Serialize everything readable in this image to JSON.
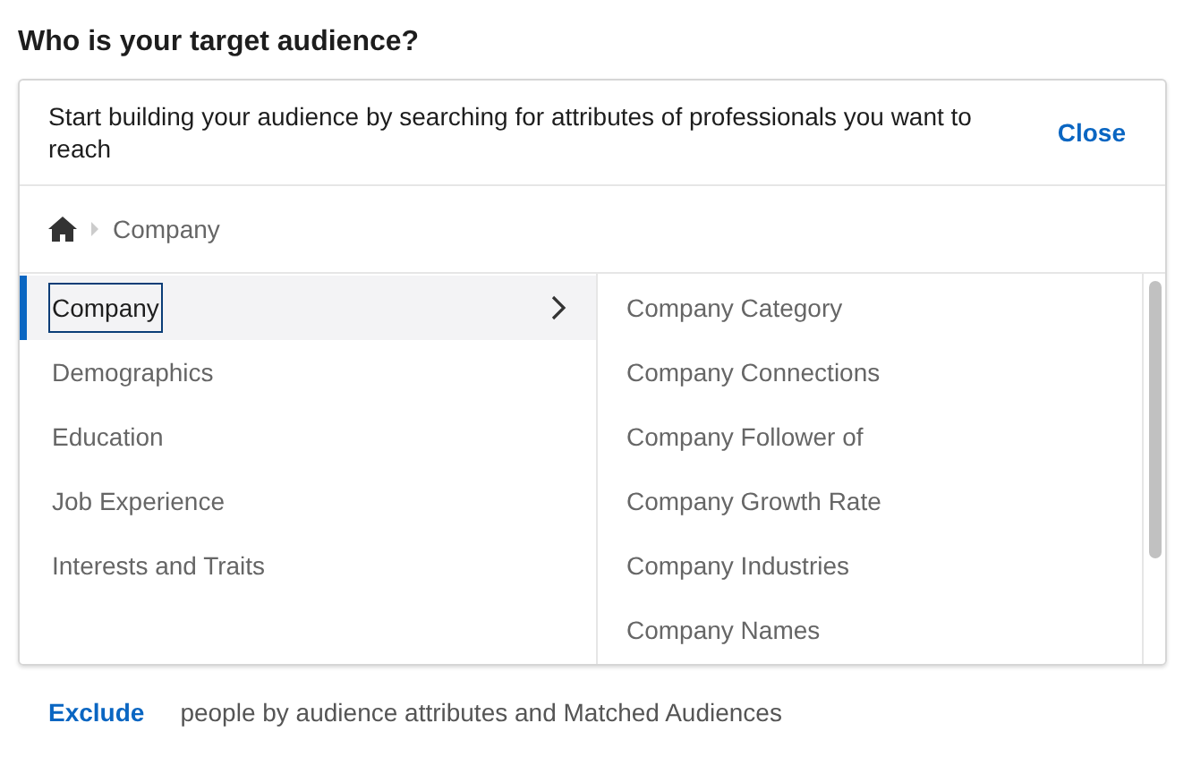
{
  "heading": "Who is your target audience?",
  "panel": {
    "intro": "Start building your audience by searching for attributes of professionals you want to reach",
    "close_label": "Close",
    "breadcrumb": [
      "Company"
    ],
    "categories": [
      {
        "label": "Company",
        "selected": true
      },
      {
        "label": "Demographics",
        "selected": false
      },
      {
        "label": "Education",
        "selected": false
      },
      {
        "label": "Job Experience",
        "selected": false
      },
      {
        "label": "Interests and Traits",
        "selected": false
      }
    ],
    "subcategories": [
      "Company Category",
      "Company Connections",
      "Company Follower of",
      "Company Growth Rate",
      "Company Industries",
      "Company Names"
    ]
  },
  "footer": {
    "link": "Exclude",
    "text": "people by audience attributes and Matched Audiences"
  }
}
